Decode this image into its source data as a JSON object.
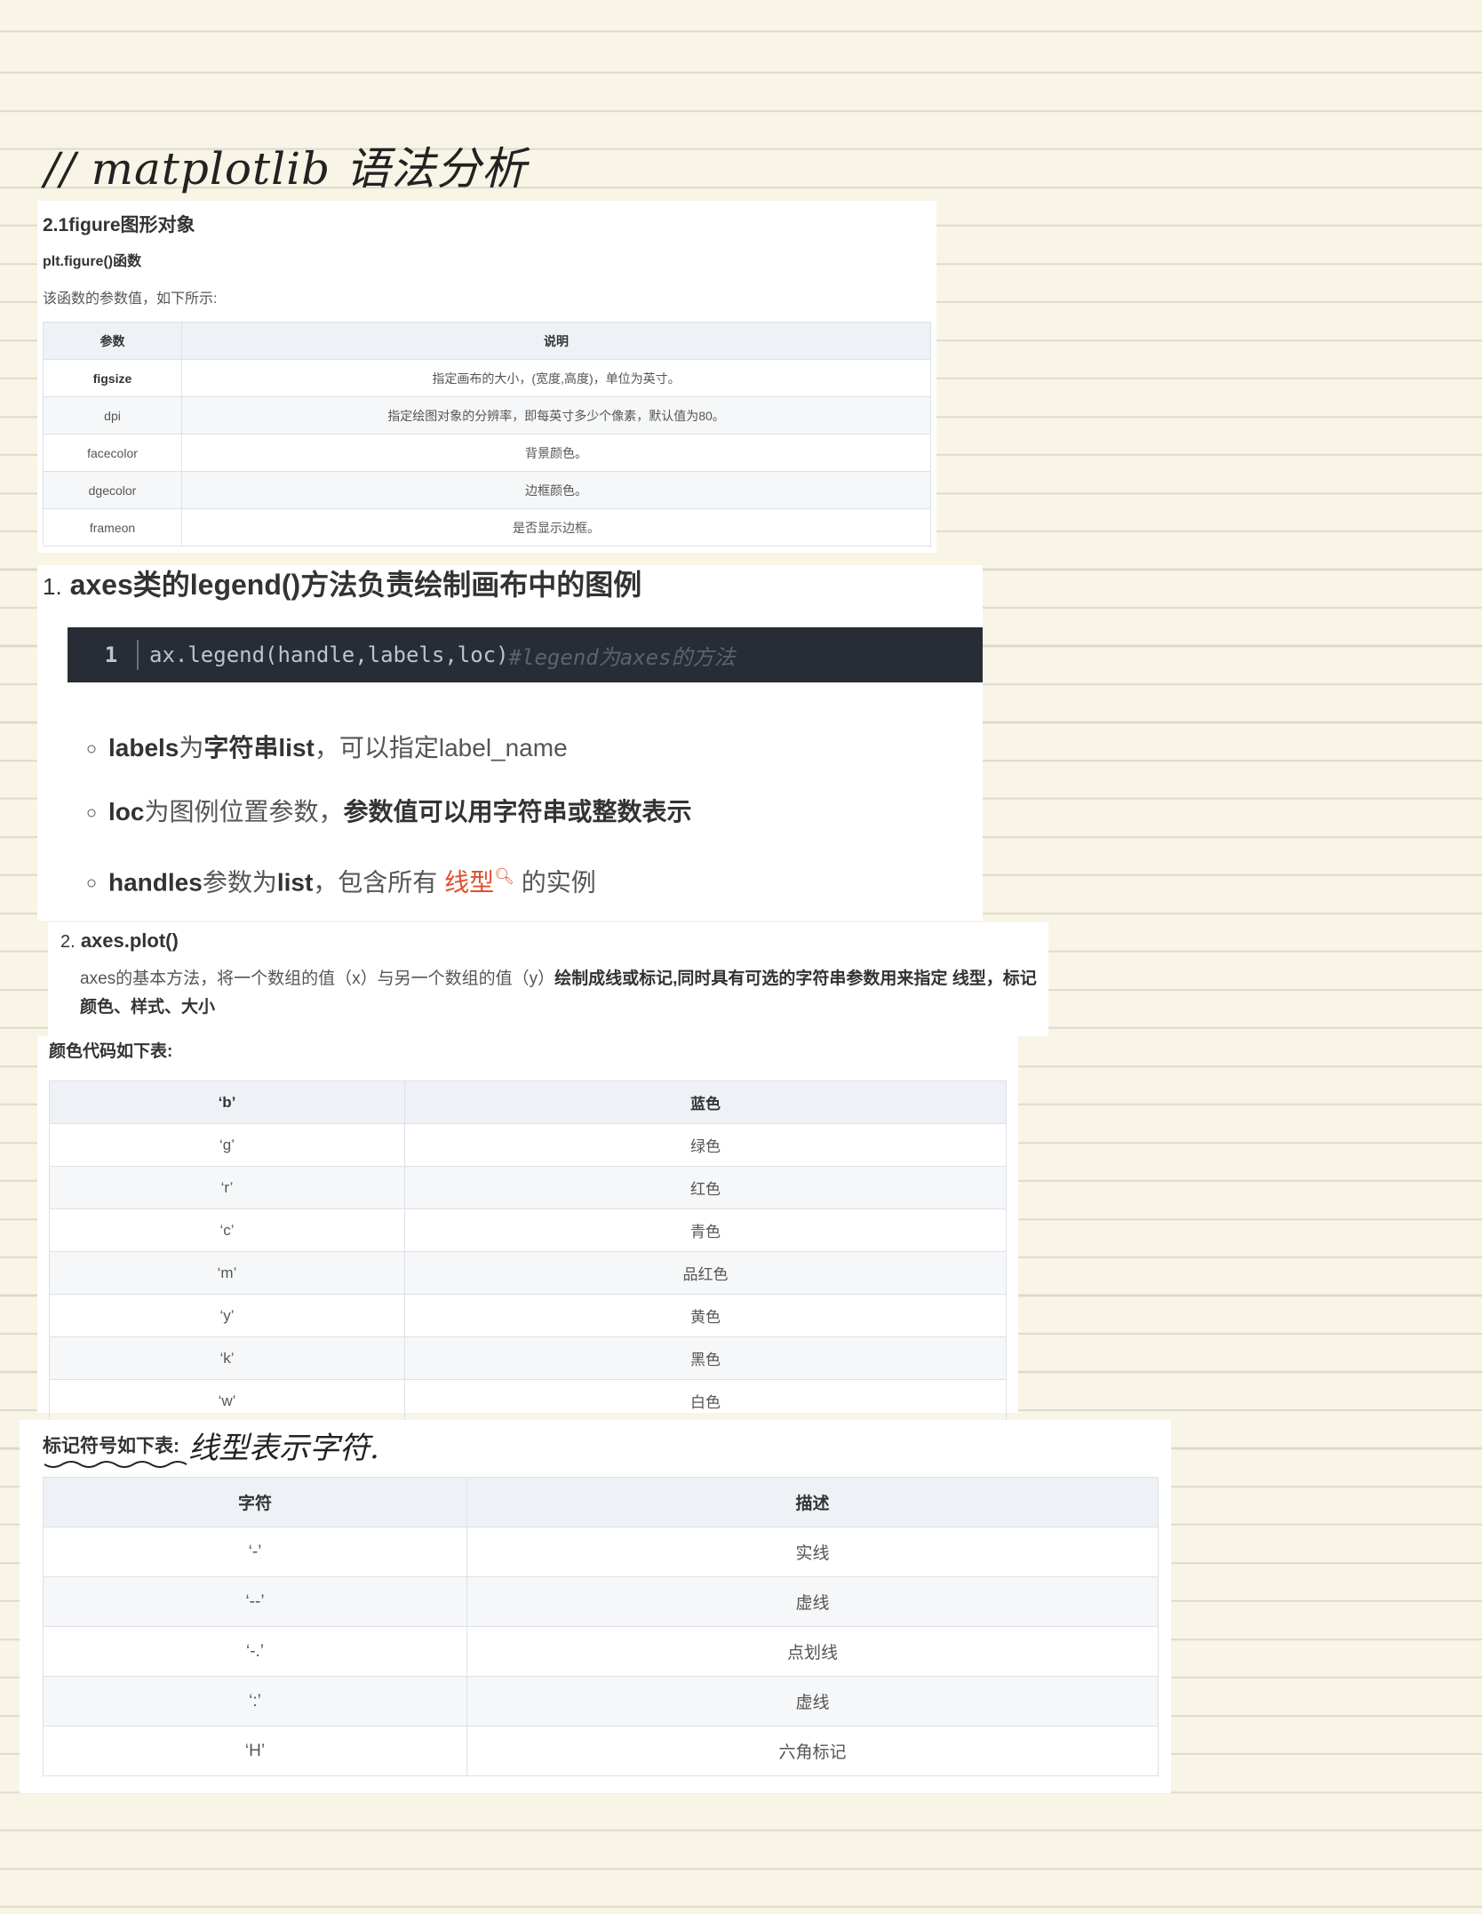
{
  "handwritten_title": "// matplotlib 语法分析",
  "figure_section": {
    "heading": "2.1figure图形对象",
    "subheading": "plt.figure()函数",
    "intro": "该函数的参数值，如下所示:",
    "columns": [
      "参数",
      "说明"
    ],
    "rows": [
      [
        "figsize",
        "指定画布的大小，(宽度,高度)，单位为英寸。"
      ],
      [
        "dpi",
        "指定绘图对象的分辨率，即每英寸多少个像素，默认值为80。"
      ],
      [
        "facecolor",
        "背景颜色。"
      ],
      [
        "dgecolor",
        "边框颜色。"
      ],
      [
        "frameon",
        "是否显示边框。"
      ]
    ]
  },
  "legend_section": {
    "number": "1.",
    "title": "axes类的legend()方法负责绘制画布中的图例",
    "code_line_number": "1",
    "code": "ax.legend(handle,labels,loc)",
    "code_comment": "#legend为axes的方法",
    "bullet1_a": "labels",
    "bullet1_b": "为",
    "bullet1_c": "字符串list",
    "bullet1_d": "，可以指定label_name",
    "bullet2_a": "loc",
    "bullet2_b": "为图例位置参数，",
    "bullet2_c": "参数值可以用字符串或整数表示",
    "bullet3_a": "handles",
    "bullet3_b": "参数为",
    "bullet3_c": "list",
    "bullet3_d": "，包含所有 ",
    "bullet3_link": "线型",
    "bullet3_e": " 的实例"
  },
  "plot_section": {
    "number": "2.",
    "title": "axes.plot()",
    "text_plain": "axes的基本方法，将一个数组的值（x）与另一个数组的值（y）",
    "text_bold": "绘制成线或标记,同时具有可选的字符串参数用来指定 线型，标记颜色、样式、大小"
  },
  "color_section": {
    "heading": "颜色代码如下表:",
    "columns": [
      "‘b’",
      "蓝色"
    ],
    "rows": [
      [
        "‘g’",
        "绿色"
      ],
      [
        "‘r’",
        "红色"
      ],
      [
        "‘c’",
        "青色"
      ],
      [
        "‘m’",
        "品红色"
      ],
      [
        "‘y’",
        "黄色"
      ],
      [
        "‘k’",
        "黑色"
      ],
      [
        "‘w’",
        "白色"
      ]
    ]
  },
  "marker_section": {
    "heading": "标记符号如下表:",
    "handwritten_note": "线型表示字符.",
    "columns": [
      "字符",
      "描述"
    ],
    "rows": [
      [
        "‘-’",
        "实线"
      ],
      [
        "‘--’",
        "虚线"
      ],
      [
        "‘-.’",
        "点划线"
      ],
      [
        "‘:’",
        "虚线"
      ],
      [
        "‘H’",
        "六角标记"
      ]
    ]
  }
}
